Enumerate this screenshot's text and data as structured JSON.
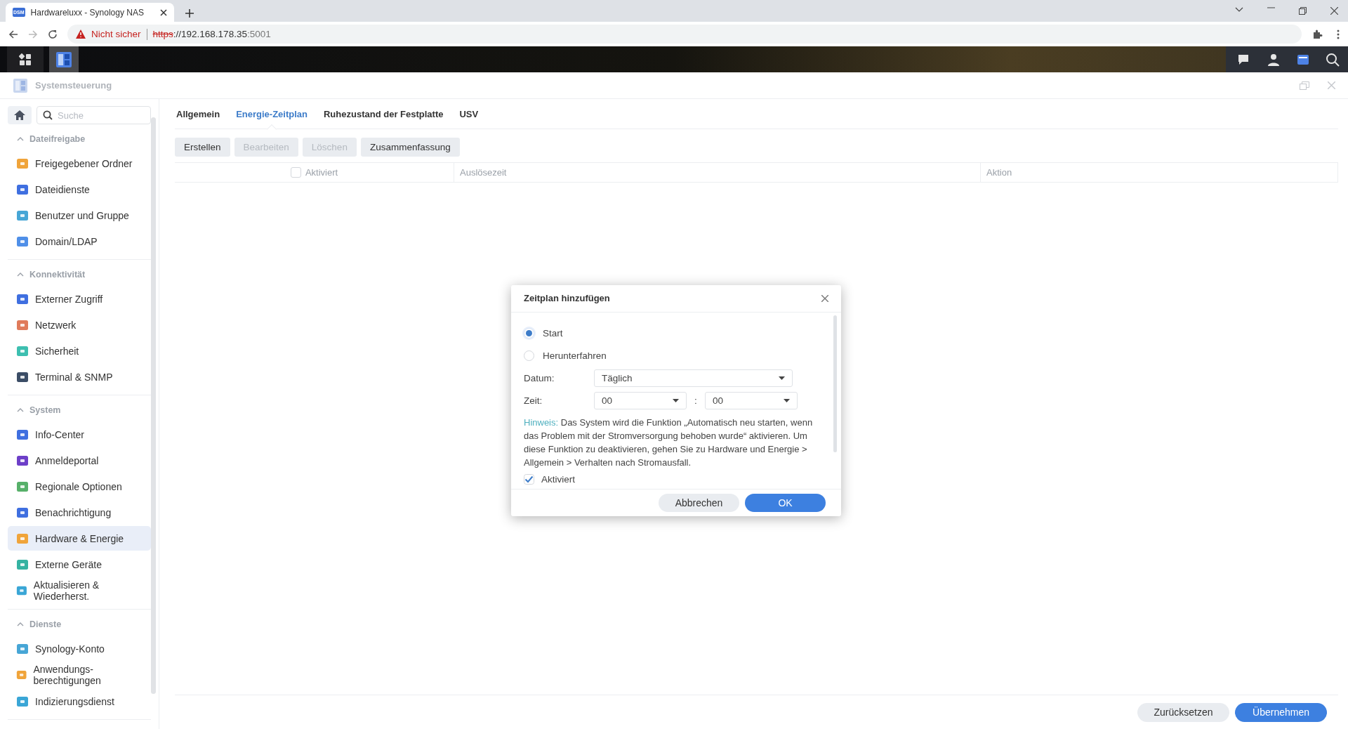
{
  "browser": {
    "tab_title": "Hardwareluxx - Synology NAS",
    "favicon_text": "DSM",
    "address": {
      "warning": "Nicht sicher",
      "scheme": "https",
      "host": "://192.168.178.35",
      "port": ":5001"
    }
  },
  "window": {
    "title": "Systemsteuerung"
  },
  "sidebar": {
    "search_placeholder": "Suche",
    "sections": [
      {
        "title": "Dateifreigabe",
        "expanded": true,
        "items": [
          {
            "label": "Freigegebener Ordner",
            "selected": false
          },
          {
            "label": "Dateidienste",
            "selected": false
          },
          {
            "label": "Benutzer und Gruppe",
            "selected": false
          },
          {
            "label": "Domain/LDAP",
            "selected": false
          }
        ]
      },
      {
        "title": "Konnektivität",
        "expanded": true,
        "items": [
          {
            "label": "Externer Zugriff",
            "selected": false
          },
          {
            "label": "Netzwerk",
            "selected": false
          },
          {
            "label": "Sicherheit",
            "selected": false
          },
          {
            "label": "Terminal & SNMP",
            "selected": false
          }
        ]
      },
      {
        "title": "System",
        "expanded": true,
        "items": [
          {
            "label": "Info-Center",
            "selected": false
          },
          {
            "label": "Anmeldeportal",
            "selected": false
          },
          {
            "label": "Regionale Optionen",
            "selected": false
          },
          {
            "label": "Benachrichtigung",
            "selected": false
          },
          {
            "label": "Hardware & Energie",
            "selected": true
          },
          {
            "label": "Externe Geräte",
            "selected": false
          },
          {
            "label": "Aktualisieren & Wiederherst.",
            "selected": false
          }
        ]
      },
      {
        "title": "Dienste",
        "expanded": true,
        "items": [
          {
            "label": "Synology-Konto",
            "selected": false
          },
          {
            "label": "Anwendungs-berechtigungen",
            "selected": false
          },
          {
            "label": "Indizierungsdienst",
            "selected": false
          }
        ]
      }
    ]
  },
  "tabs": [
    {
      "label": "Allgemein",
      "selected": false
    },
    {
      "label": "Energie-Zeitplan",
      "selected": true
    },
    {
      "label": "Ruhezustand der Festplatte",
      "selected": false
    },
    {
      "label": "USV",
      "selected": false
    }
  ],
  "toolbar": [
    {
      "label": "Erstellen",
      "disabled": false
    },
    {
      "label": "Bearbeiten",
      "disabled": true
    },
    {
      "label": "Löschen",
      "disabled": true
    },
    {
      "label": "Zusammenfassung",
      "disabled": false
    }
  ],
  "table": {
    "columns": [
      {
        "label": "Aktiviert",
        "kind": "checkbox",
        "checked": false
      },
      {
        "label": "Auslösezeit",
        "kind": "text"
      },
      {
        "label": "Aktion",
        "kind": "text"
      }
    ]
  },
  "dialog": {
    "title": "Zeitplan hinzufügen",
    "options": [
      {
        "label": "Start",
        "selected": true
      },
      {
        "label": "Herunterfahren",
        "selected": false
      }
    ],
    "date": {
      "label": "Datum:",
      "value": "Täglich"
    },
    "time": {
      "label": "Zeit:",
      "hour": "00",
      "separator": ":",
      "minute": "00"
    },
    "hint": {
      "label": "Hinweis:",
      "text": "Das System wird die Funktion „Automatisch neu starten, wenn das Problem mit der Stromversorgung behoben wurde“ aktivieren. Um diese Funktion zu deaktivieren, gehen Sie zu Hardware und Energie > Allgemein > Verhalten nach Stromausfall."
    },
    "enabled": {
      "label": "Aktiviert",
      "checked": true
    },
    "buttons": [
      {
        "label": "Abbrechen",
        "kind": "secondary"
      },
      {
        "label": "OK",
        "kind": "primary"
      }
    ]
  },
  "footer": {
    "buttons": [
      {
        "label": "Zurücksetzen",
        "kind": "secondary"
      },
      {
        "label": "Übernehmen",
        "kind": "primary"
      }
    ]
  }
}
